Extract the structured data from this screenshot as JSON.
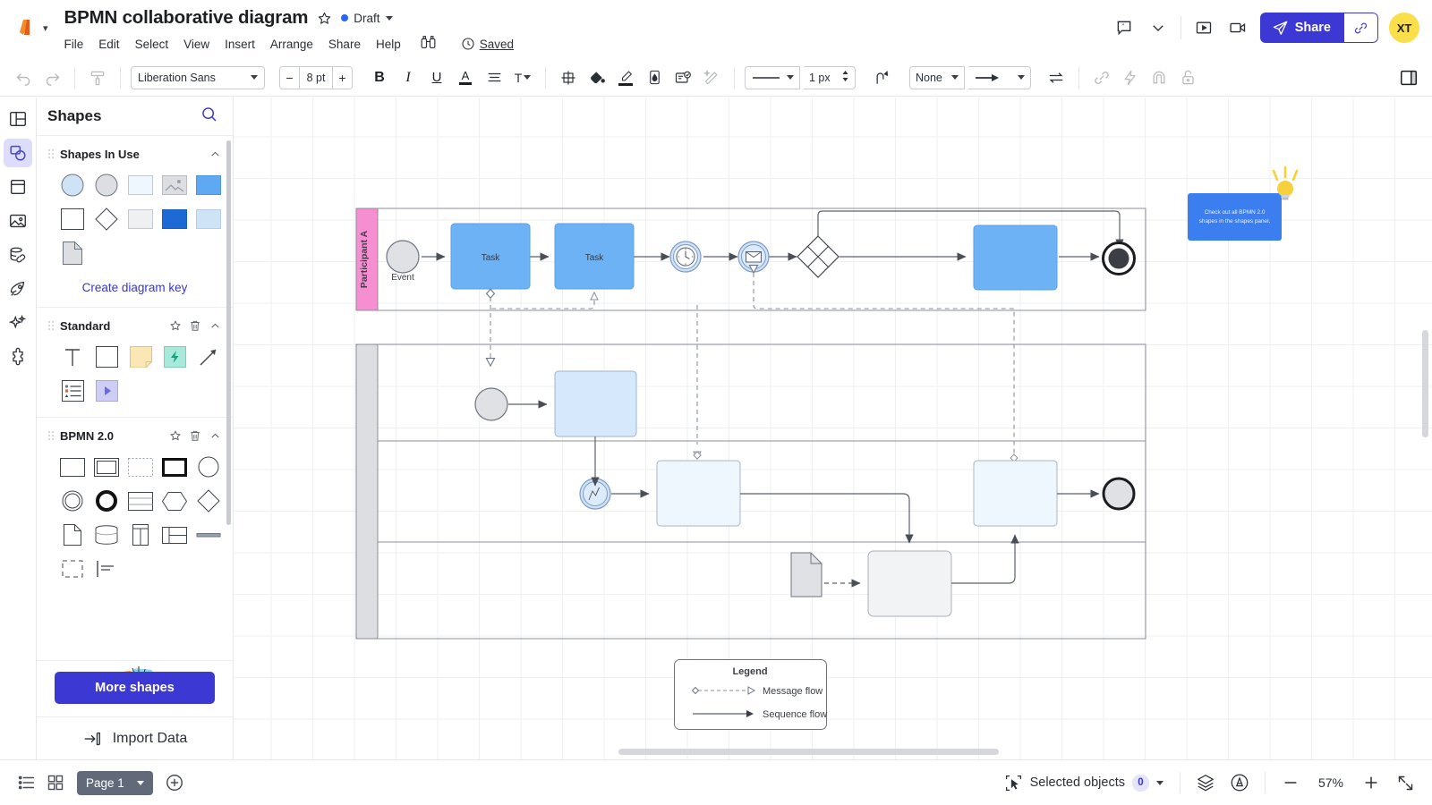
{
  "header": {
    "logo": "lucid-logo",
    "doc_title": "BPMN collaborative diagram",
    "star_icon": "star-outline-icon",
    "status_label": "Draft",
    "status_color": "#2a66f6",
    "menu": [
      "File",
      "Edit",
      "Select",
      "View",
      "Insert",
      "Arrange",
      "Share",
      "Help"
    ],
    "binoculars_icon": "binoculars-icon",
    "saved_label": "Saved",
    "saved_icon": "clock-icon",
    "comment_icon": "comment-icon",
    "chevron_icon": "chevron-down-icon",
    "present_icon": "present-icon",
    "record_icon": "video-record-icon",
    "share_label": "Share",
    "share_icon": "paper-plane-icon",
    "link_icon": "link-icon",
    "avatar_initials": "XT",
    "avatar_color": "#fade4a",
    "brand_color": "#3c38d4"
  },
  "toolbar": {
    "undo_icon": "undo-icon",
    "redo_icon": "redo-icon",
    "format_painter_icon": "format-painter-icon",
    "font_family": "Liberation Sans",
    "font_size": "8 pt",
    "decrease_label": "−",
    "increase_label": "+",
    "bold_label": "B",
    "italic_label": "I",
    "underline_label": "U",
    "text_color_label": "A",
    "align_icon": "text-align-icon",
    "text_options_label": "T",
    "position_icon": "position-icon",
    "fill_icon": "fill-bucket-icon",
    "line_color_icon": "pen-line-icon",
    "opacity_icon": "opacity-droplet-icon",
    "theme_icon": "theme-icon",
    "magic_icon": "magic-wand-icon",
    "line_style_icon": "line-style-icon",
    "line_weight": "1 px",
    "stepper_icon": "stepper-arrows-icon",
    "line_jump_icon": "line-jump-icon",
    "line_start": "None",
    "line_end_icon": "arrowhead-filled-icon",
    "swap_icon": "swap-arrows-icon",
    "link_icon": "link-icon",
    "action_icon": "lightning-icon",
    "magnet_icon": "magnet-icon",
    "lock_icon": "lock-open-icon",
    "right_panel_icon": "right-panel-icon"
  },
  "rail": [
    {
      "name": "layout-panel-icon",
      "label": "Layout"
    },
    {
      "name": "shapes-icon",
      "label": "Shapes",
      "active": true
    },
    {
      "name": "templates-icon",
      "label": "Templates"
    },
    {
      "name": "image-icon",
      "label": "Images"
    },
    {
      "name": "data-link-icon",
      "label": "Data"
    },
    {
      "name": "rocket-icon",
      "label": "Get started"
    },
    {
      "name": "sparkle-ai-icon",
      "label": "AI"
    },
    {
      "name": "puzzle-integration-icon",
      "label": "Integrations"
    }
  ],
  "shapes_panel": {
    "title": "Shapes",
    "search_icon": "search-icon",
    "sections": [
      {
        "title": "Shapes In Use",
        "has_star": false,
        "has_trash": false,
        "collapse_icon": "chevron-up-icon",
        "shapes": [
          {
            "name": "circle-blue-shape"
          },
          {
            "name": "circle-gray-shape"
          },
          {
            "name": "rect-pale-blue-shape"
          },
          {
            "name": "image-placeholder-shape"
          },
          {
            "name": "rect-blue-shape"
          },
          {
            "name": "rect-white-shape"
          },
          {
            "name": "diamond-shape"
          },
          {
            "name": "rect-light-gray-shape"
          },
          {
            "name": "rect-strong-blue-shape"
          },
          {
            "name": "rect-lighter-blue-shape"
          },
          {
            "name": "document-shape"
          }
        ],
        "link_label": "Create diagram key"
      },
      {
        "title": "Standard",
        "has_star": true,
        "has_trash": true,
        "star_icon": "star-outline-icon",
        "trash_icon": "trash-icon",
        "collapse_icon": "chevron-up-icon",
        "shapes": [
          {
            "name": "text-shape"
          },
          {
            "name": "rectangle-shape"
          },
          {
            "name": "sticky-note-shape"
          },
          {
            "name": "action-item-shape"
          },
          {
            "name": "line-arrow-shape"
          },
          {
            "name": "list-shape"
          },
          {
            "name": "button-shape"
          }
        ]
      },
      {
        "title": "BPMN 2.0",
        "has_star": true,
        "has_trash": true,
        "star_icon": "star-outline-icon",
        "trash_icon": "trash-icon",
        "collapse_icon": "chevron-up-icon",
        "shapes": [
          {
            "name": "bpmn-task-shape"
          },
          {
            "name": "bpmn-subprocess-shape"
          },
          {
            "name": "bpmn-adhoc-dashed-shape"
          },
          {
            "name": "bpmn-call-activity-shape"
          },
          {
            "name": "bpmn-start-event-shape"
          },
          {
            "name": "bpmn-intermediate-event-shape"
          },
          {
            "name": "bpmn-end-event-shape"
          },
          {
            "name": "bpmn-pool-shape"
          },
          {
            "name": "bpmn-hexagon-shape"
          },
          {
            "name": "bpmn-gateway-shape"
          },
          {
            "name": "bpmn-data-object-shape"
          },
          {
            "name": "bpmn-data-store-shape"
          },
          {
            "name": "bpmn-vertical-pool-shape"
          },
          {
            "name": "bpmn-lane-shape"
          },
          {
            "name": "bpmn-group-line-shape"
          },
          {
            "name": "bpmn-group-dashed-shape"
          },
          {
            "name": "bpmn-annotation-shape"
          }
        ]
      }
    ],
    "more_shapes_label": "More shapes",
    "import_data_label": "Import Data",
    "import_icon": "import-arrow-icon"
  },
  "canvas": {
    "sticky_note": {
      "text": "Check out all BPMN 2.0 shapes in the shapes panel.",
      "color": "#3b7ef0",
      "bulb_icon": "lightbulb-icon"
    },
    "pool_top": {
      "lane_label": "Participant A",
      "lane_color": "#f58fd2",
      "nodes": [
        {
          "name": "start-event",
          "label": "Event",
          "type": "start-event"
        },
        {
          "name": "task-1",
          "label": "Task",
          "type": "task",
          "color": "#6cb2f5"
        },
        {
          "name": "task-2",
          "label": "Task",
          "type": "task",
          "color": "#6cb2f5"
        },
        {
          "name": "timer-event",
          "label": "",
          "type": "timer-intermediate-event"
        },
        {
          "name": "message-event",
          "label": "",
          "type": "message-intermediate-event"
        },
        {
          "name": "gateway",
          "label": "",
          "type": "parallel-gateway"
        },
        {
          "name": "task-3",
          "label": "",
          "type": "task",
          "color": "#6cb2f5"
        },
        {
          "name": "end-event",
          "label": "",
          "type": "end-event"
        }
      ]
    },
    "pool_bottom": {
      "lane_label": "",
      "nodes": [
        {
          "name": "start-event-2",
          "label": "",
          "type": "start-event"
        },
        {
          "name": "task-4",
          "label": "",
          "type": "task",
          "color": "#d6e8fb"
        },
        {
          "name": "escalation-event",
          "label": "",
          "type": "escalation-event"
        },
        {
          "name": "task-5",
          "label": "",
          "type": "task",
          "color": "#eef6fe"
        },
        {
          "name": "task-6",
          "label": "",
          "type": "task",
          "color": "#f2f3f4"
        },
        {
          "name": "data-object",
          "label": "",
          "type": "data-object"
        },
        {
          "name": "task-7",
          "label": "",
          "type": "task",
          "color": "#eef6fe"
        },
        {
          "name": "end-event-2",
          "label": "",
          "type": "end-event-gray"
        }
      ]
    },
    "legend": {
      "title": "Legend",
      "items": [
        {
          "label": "Message flow",
          "style": "dashed"
        },
        {
          "label": "Sequence flow",
          "style": "solid"
        }
      ]
    }
  },
  "status_bar": {
    "outline_icon": "outline-list-icon",
    "grid_icon": "grid-pages-icon",
    "page_label": "Page 1",
    "page_caret_icon": "chevron-down-icon",
    "add_page_icon": "plus-circle-icon",
    "selected_objects_label": "Selected objects",
    "selected_objects_count": "0",
    "select_icon": "cursor-select-icon",
    "select_caret_icon": "chevron-down-icon",
    "layers_icon": "layers-icon",
    "accessibility_icon": "accessibility-icon",
    "zoom_out_icon": "minus-icon",
    "zoom_level": "57%",
    "zoom_in_icon": "plus-icon",
    "fullscreen_icon": "fullscreen-icon"
  }
}
